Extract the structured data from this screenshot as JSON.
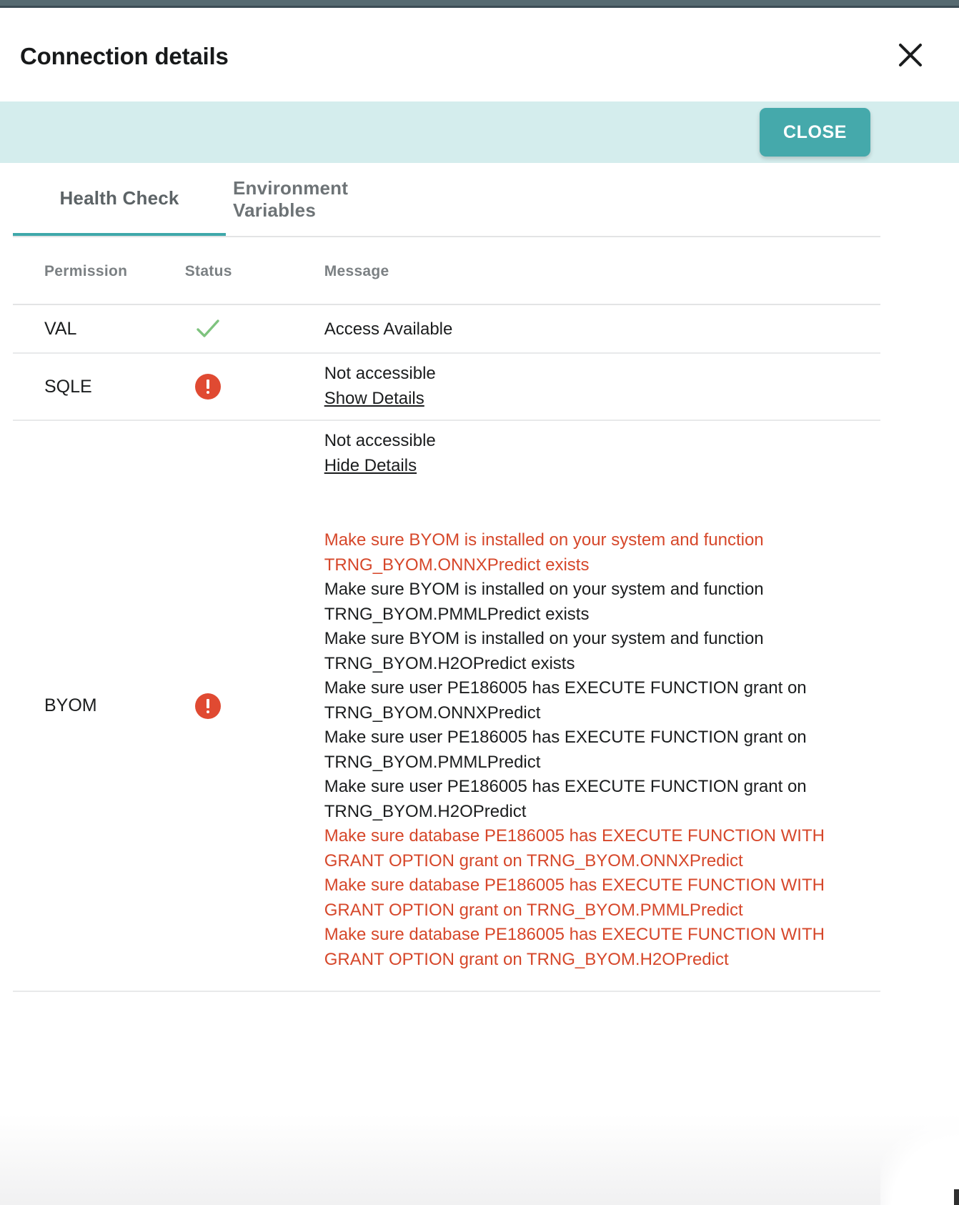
{
  "header": {
    "title": "Connection details",
    "close_icon": "close-icon"
  },
  "action_bar": {
    "close_label": "CLOSE"
  },
  "tabs": [
    {
      "label": "Health Check",
      "active": true
    },
    {
      "label": "Environment Variables",
      "active": false
    }
  ],
  "table": {
    "columns": [
      "Permission",
      "Status",
      "Message"
    ],
    "rows": [
      {
        "permission": "VAL",
        "status": "success",
        "status_icon": "check-icon",
        "message": "Access Available",
        "link": null
      },
      {
        "permission": "SQLE",
        "status": "error",
        "status_icon": "error-icon",
        "message": "Not accessible",
        "link": "Show Details"
      },
      {
        "permission": "BYOM",
        "status": "error",
        "status_icon": "error-icon",
        "message": "Not accessible",
        "link": "Hide Details",
        "details": [
          {
            "text": "Make sure BYOM is installed on your system and function TRNG_BYOM.ONNXPredict exists",
            "severity": "error"
          },
          {
            "text": "Make sure BYOM is installed on your system and function TRNG_BYOM.PMMLPredict exists",
            "severity": "normal"
          },
          {
            "text": "Make sure BYOM is installed on your system and function TRNG_BYOM.H2OPredict exists",
            "severity": "normal"
          },
          {
            "text": "Make sure user PE186005 has EXECUTE FUNCTION grant on TRNG_BYOM.ONNXPredict",
            "severity": "normal"
          },
          {
            "text": "Make sure user PE186005 has EXECUTE FUNCTION grant on TRNG_BYOM.PMMLPredict",
            "severity": "normal"
          },
          {
            "text": "Make sure user PE186005 has EXECUTE FUNCTION grant on TRNG_BYOM.H2OPredict",
            "severity": "normal"
          },
          {
            "text": "Make sure database PE186005 has EXECUTE FUNCTION WITH GRANT OPTION grant on TRNG_BYOM.ONNXPredict",
            "severity": "error"
          },
          {
            "text": "Make sure database PE186005 has EXECUTE FUNCTION WITH GRANT OPTION grant on TRNG_BYOM.PMMLPredict",
            "severity": "error"
          },
          {
            "text": "Make sure database PE186005 has EXECUTE FUNCTION WITH GRANT OPTION grant on TRNG_BYOM.H2OPredict",
            "severity": "error"
          }
        ]
      }
    ]
  },
  "colors": {
    "accent_teal": "#45a9ab",
    "band_teal": "#d4eded",
    "error_red": "#e04a32",
    "error_text": "#d6472a",
    "success_green": "#7ec37e",
    "topbar_slate": "#566a71"
  }
}
